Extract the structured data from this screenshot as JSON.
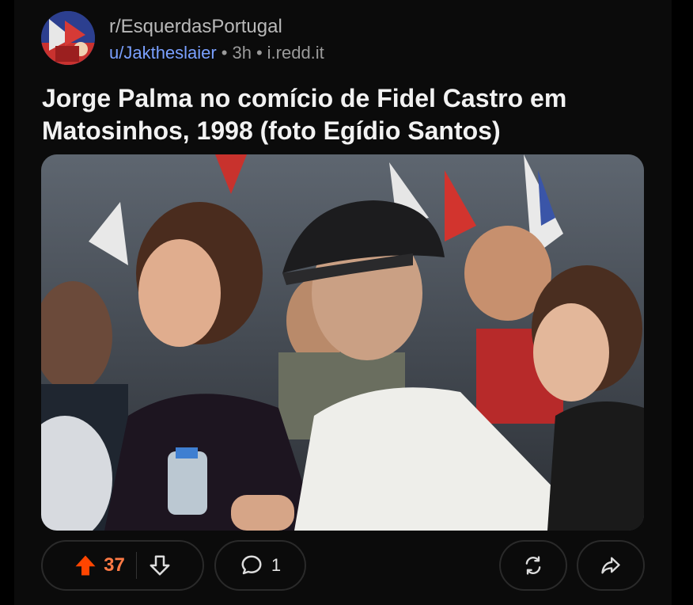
{
  "post": {
    "subreddit": "r/EsquerdasPortugal",
    "user": "u/Jaktheslaier",
    "age": "3h",
    "domain": "i.redd.it",
    "separator": "•",
    "title": "Jorge Palma no comício de Fidel Castro em Matosinhos, 1998 (foto Egídio Santos)"
  },
  "actions": {
    "score": "37",
    "comments": "1"
  },
  "icons": {
    "upvote": "upvote-arrow-icon",
    "downvote": "downvote-arrow-icon",
    "comment": "comment-bubble-icon",
    "repost": "repost-icon",
    "share": "share-arrow-icon"
  },
  "colors": {
    "upvote_active": "#ff4500",
    "score": "#ff7a45",
    "user_link": "#7aa0ff"
  }
}
